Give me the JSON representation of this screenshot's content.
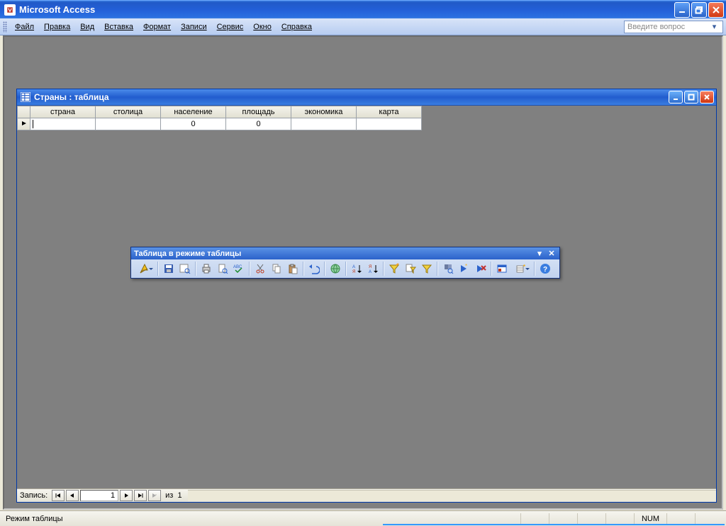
{
  "app": {
    "title": "Microsoft Access"
  },
  "menu": {
    "file": "Файл",
    "edit": "Правка",
    "view": "Вид",
    "insert": "Вставка",
    "format": "Формат",
    "records": "Записи",
    "tools": "Сервис",
    "window": "Окно",
    "help": "Справка"
  },
  "help_box_placeholder": "Введите вопрос",
  "doc": {
    "title": "Страны : таблица",
    "columns": [
      "страна",
      "столица",
      "население",
      "площадь",
      "экономика",
      "карта"
    ],
    "row": {
      "country": "",
      "capital": "",
      "population": "0",
      "area": "0",
      "economy": "",
      "map": ""
    },
    "record_nav": {
      "label": "Запись:",
      "current": "1",
      "of_label": "из",
      "total": "1"
    }
  },
  "toolbar_title": "Таблица в режиме таблицы",
  "status": {
    "mode": "Режим таблицы",
    "num": "NUM"
  }
}
